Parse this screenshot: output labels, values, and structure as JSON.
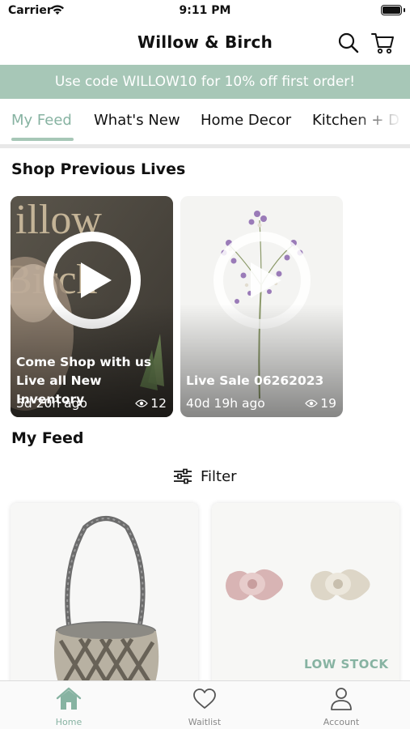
{
  "status_bar": {
    "carrier": "Carrier",
    "time": "9:11 PM"
  },
  "header": {
    "title": "Willow & Birch",
    "search_icon": "search-icon",
    "cart_icon": "cart-icon"
  },
  "promo": {
    "text": "Use code WILLOW10 for 10% off first order!"
  },
  "tabs": [
    {
      "label": "My Feed",
      "active": true
    },
    {
      "label": "What's New"
    },
    {
      "label": "Home Decor"
    },
    {
      "label": "Kitchen + D"
    }
  ],
  "lives_section": {
    "title": "Shop Previous Lives",
    "cards": [
      {
        "title_line1": "Come Shop with us",
        "title_line2": "Live all New Inventory",
        "age": "5d 20h ago",
        "views": "12",
        "backdrop_text_1": "illow",
        "backdrop_text_2": "Birch"
      },
      {
        "title_line1": "Live Sale 06262023",
        "age": "40d 19h ago",
        "views": "19"
      }
    ]
  },
  "feed": {
    "title": "My Feed",
    "filter_label": "Filter",
    "products": [
      {
        "name": "basket-product"
      },
      {
        "name": "pacifier-product",
        "badge": "LOW STOCK"
      }
    ]
  },
  "bottom_nav": [
    {
      "label": "Home",
      "icon": "home-icon",
      "active": true
    },
    {
      "label": "Waitlist",
      "icon": "heart-icon"
    },
    {
      "label": "Account",
      "icon": "person-icon"
    }
  ],
  "colors": {
    "accent": "#a7c7b7",
    "accent_text": "#87b3a2"
  }
}
